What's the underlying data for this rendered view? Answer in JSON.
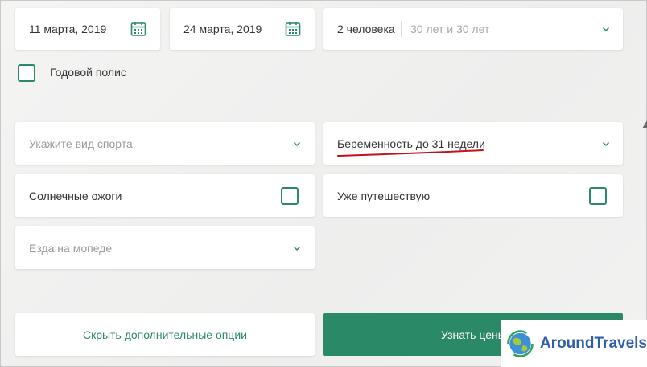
{
  "trip": {
    "date_from": "11 марта, 2019",
    "date_to": "24 марта, 2019",
    "travellers": "2 человека",
    "travellers_ages": "30 лет и 30 лет"
  },
  "annual_policy": {
    "label": "Годовой полис"
  },
  "options": {
    "sport_placeholder": "Укажите вид спорта",
    "pregnancy_value": "Беременность до 31 недели",
    "sunburn_label": "Солнечные ожоги",
    "already_travelling_label": "Уже путешествую",
    "moped_placeholder": "Езда на мопеде"
  },
  "buttons": {
    "hide_options": "Скрыть дополнительные опции",
    "get_price": "Узнать цены"
  },
  "watermark": {
    "brand": "AroundTravels"
  },
  "colors": {
    "accent": "#2a8a68",
    "annotation": "#c0141b",
    "brand": "#2f5fa8"
  }
}
